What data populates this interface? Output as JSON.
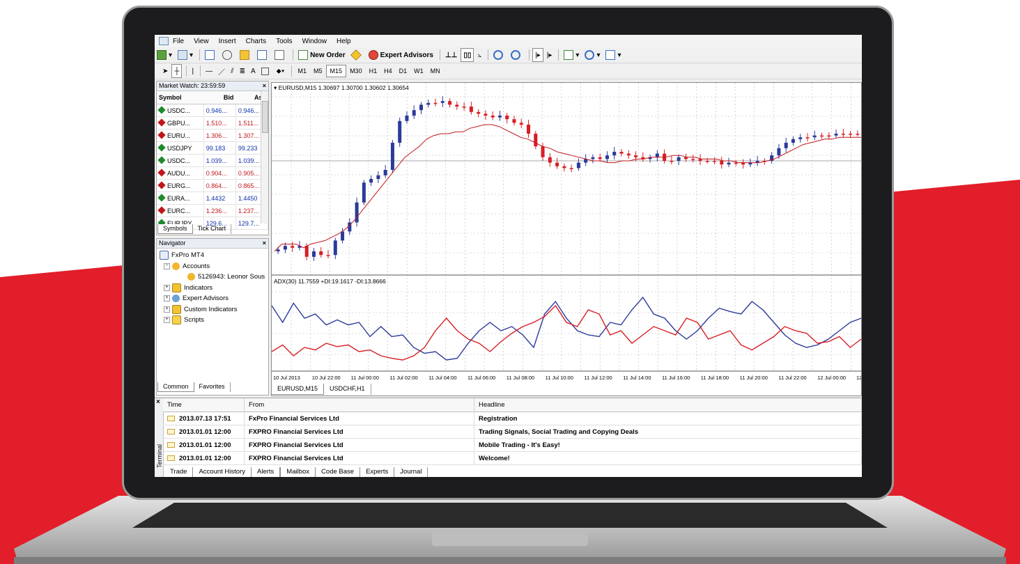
{
  "menu": [
    "File",
    "View",
    "Insert",
    "Charts",
    "Tools",
    "Window",
    "Help"
  ],
  "toolbar": {
    "new_order": "New Order",
    "expert_advisors": "Expert Advisors",
    "timeframes": [
      "M1",
      "M5",
      "M15",
      "M30",
      "H1",
      "H4",
      "D1",
      "W1",
      "MN"
    ],
    "active_timeframe": "M15",
    "text_tool": "A"
  },
  "market_watch": {
    "title": "Market Watch: 23:59:59",
    "headers": [
      "Symbol",
      "Bid",
      "Ask"
    ],
    "rows": [
      {
        "symbol": "USDC...",
        "bid": "0.946...",
        "ask": "0.946...",
        "dir": "up"
      },
      {
        "symbol": "GBPU...",
        "bid": "1.510...",
        "ask": "1.511...",
        "dir": "down"
      },
      {
        "symbol": "EURU...",
        "bid": "1.306...",
        "ask": "1.307...",
        "dir": "down"
      },
      {
        "symbol": "USDJPY",
        "bid": "99.183",
        "ask": "99.233",
        "dir": "up"
      },
      {
        "symbol": "USDC...",
        "bid": "1.039...",
        "ask": "1.039...",
        "dir": "up"
      },
      {
        "symbol": "AUDU...",
        "bid": "0.904...",
        "ask": "0.905...",
        "dir": "down"
      },
      {
        "symbol": "EURG...",
        "bid": "0.864...",
        "ask": "0.865...",
        "dir": "down"
      },
      {
        "symbol": "EURA...",
        "bid": "1.4432",
        "ask": "1.4450",
        "dir": "up"
      },
      {
        "symbol": "EURC...",
        "bid": "1.236...",
        "ask": "1.237...",
        "dir": "down"
      },
      {
        "symbol": "EURJPY",
        "bid": "129.6...",
        "ask": "129.7...",
        "dir": "up"
      }
    ],
    "tabs": [
      "Symbols",
      "Tick Chart"
    ]
  },
  "navigator": {
    "title": "Navigator",
    "root": "FxPro MT4",
    "accounts": "Accounts",
    "account": "5126943: Leonor Sous",
    "items": [
      "Indicators",
      "Expert Advisors",
      "Custom Indicators",
      "Scripts"
    ],
    "tabs": [
      "Common",
      "Favorites"
    ]
  },
  "chart": {
    "header": "EURUSD,M15  1.30697 1.30700 1.30602 1.30654",
    "indicator_header": "ADX(30) 11.7559 +DI:19.1617 -DI:13.8666",
    "time_labels": [
      "10 Jul 2013",
      "10 Jul 22:00",
      "11 Jul 00:00",
      "11 Jul 02:00",
      "11 Jul 04:00",
      "11 Jul 06:00",
      "11 Jul 08:00",
      "11 Jul 10:00",
      "11 Jul 12:00",
      "11 Jul 14:00",
      "11 Jul 16:00",
      "11 Jul 18:00",
      "11 Jul 20:00",
      "11 Jul 22:00",
      "12 Jul 00:00",
      "12"
    ],
    "tabs": [
      "EURUSD,M15",
      "USDCHF,H1"
    ],
    "colors": {
      "bull": "#2b3a9a",
      "bear": "#d81e25",
      "ma": "#c0161b",
      "grid": "#b8b8b8"
    }
  },
  "chart_data": {
    "type": "line",
    "series": [
      {
        "values": [
          0.89,
          0.87,
          0.88,
          0.87,
          0.93,
          0.9,
          0.92,
          0.92,
          0.84,
          0.79,
          0.74,
          0.63,
          0.52,
          0.5,
          0.48,
          0.45,
          0.3,
          0.18,
          0.15,
          0.12,
          0.09,
          0.08,
          0.08,
          0.07,
          0.09,
          0.1,
          0.1,
          0.13,
          0.14,
          0.15,
          0.16,
          0.15,
          0.17,
          0.19,
          0.2,
          0.25,
          0.32,
          0.38,
          0.41,
          0.43,
          0.44,
          0.44,
          0.41,
          0.39,
          0.38,
          0.39,
          0.37,
          0.35,
          0.36,
          0.37,
          0.38,
          0.39,
          0.38,
          0.36,
          0.4,
          0.4,
          0.38,
          0.39,
          0.39,
          0.4,
          0.4,
          0.4,
          0.42,
          0.41,
          0.41,
          0.42,
          0.41,
          0.4,
          0.4,
          0.37,
          0.33,
          0.3,
          0.28,
          0.27,
          0.27,
          0.26,
          0.26,
          0.26,
          0.25,
          0.25,
          0.25,
          0.25
        ]
      },
      {
        "values": [
          0.9,
          0.86,
          0.86,
          0.86,
          0.88,
          0.86,
          0.85,
          0.84,
          0.82,
          0.8,
          0.77,
          0.73,
          0.68,
          0.63,
          0.58,
          0.53,
          0.48,
          0.43,
          0.38,
          0.35,
          0.32,
          0.28,
          0.26,
          0.25,
          0.25,
          0.24,
          0.24,
          0.22,
          0.21,
          0.2,
          0.2,
          0.21,
          0.23,
          0.25,
          0.27,
          0.28,
          0.3,
          0.32,
          0.33,
          0.35,
          0.36,
          0.37,
          0.38,
          0.39,
          0.4,
          0.4,
          0.41,
          0.41,
          0.4,
          0.4,
          0.39,
          0.39,
          0.38,
          0.38,
          0.38,
          0.37,
          0.37,
          0.38,
          0.38,
          0.39,
          0.39,
          0.39,
          0.4,
          0.4,
          0.41,
          0.41,
          0.41,
          0.41,
          0.4,
          0.39,
          0.37,
          0.35,
          0.33,
          0.31,
          0.3,
          0.29,
          0.28,
          0.28,
          0.27,
          0.27,
          0.27,
          0.27
        ]
      },
      {
        "values": [
          0.25,
          0.45,
          0.22,
          0.4,
          0.35,
          0.48,
          0.42,
          0.48,
          0.45,
          0.62,
          0.5,
          0.62,
          0.6,
          0.75,
          0.82,
          0.8,
          0.9,
          0.88,
          0.7,
          0.55,
          0.45,
          0.55,
          0.5,
          0.6,
          0.75,
          0.35,
          0.2,
          0.4,
          0.55,
          0.6,
          0.62,
          0.45,
          0.48,
          0.3,
          0.15,
          0.35,
          0.4,
          0.55,
          0.65,
          0.55,
          0.4,
          0.28,
          0.32,
          0.35,
          0.2,
          0.3,
          0.45,
          0.6,
          0.7,
          0.75,
          0.72,
          0.65,
          0.55,
          0.45,
          0.4
        ]
      },
      {
        "values": [
          0.8,
          0.72,
          0.85,
          0.75,
          0.78,
          0.7,
          0.74,
          0.72,
          0.8,
          0.78,
          0.85,
          0.88,
          0.9,
          0.85,
          0.75,
          0.55,
          0.4,
          0.55,
          0.65,
          0.7,
          0.8,
          0.68,
          0.58,
          0.5,
          0.45,
          0.38,
          0.25,
          0.45,
          0.5,
          0.3,
          0.35,
          0.6,
          0.55,
          0.7,
          0.6,
          0.5,
          0.55,
          0.6,
          0.4,
          0.45,
          0.65,
          0.6,
          0.55,
          0.72,
          0.78,
          0.7,
          0.62,
          0.5,
          0.55,
          0.58,
          0.7,
          0.68,
          0.62,
          0.75,
          0.65
        ]
      }
    ]
  },
  "terminal": {
    "label": "Terminal",
    "headers": [
      "Time",
      "From",
      "Headline"
    ],
    "rows": [
      {
        "time": "2013.07.13 17:51",
        "from": "FxPro Financial Services Ltd",
        "headline": "Registration"
      },
      {
        "time": "2013.01.01 12:00",
        "from": "FXPRO Financial Services Ltd",
        "headline": "Trading Signals, Social Trading and Copying Deals"
      },
      {
        "time": "2013.01.01 12:00",
        "from": "FXPRO Financial Services Ltd",
        "headline": "Mobile Trading - It's Easy!"
      },
      {
        "time": "2013.01.01 12:00",
        "from": "FXPRO Financial Services Ltd",
        "headline": "Welcome!"
      }
    ],
    "tabs": [
      "Trade",
      "Account History",
      "Alerts",
      "Mailbox",
      "Code Base",
      "Experts",
      "Journal"
    ],
    "active_tab": "Mailbox"
  }
}
